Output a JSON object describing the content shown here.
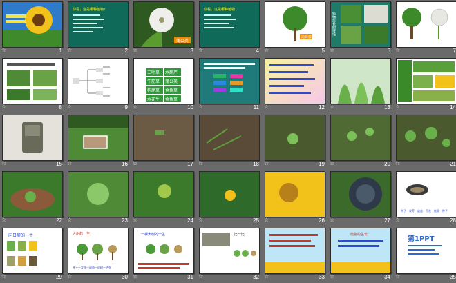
{
  "slides": [
    {
      "number": "1"
    },
    {
      "number": "2",
      "title": "你看，这是哪种植物？"
    },
    {
      "number": "3",
      "tag": "蒲公英"
    },
    {
      "number": "4",
      "title": "你看，这是哪种植物？"
    },
    {
      "number": "5",
      "tag": "向日葵"
    },
    {
      "number": "6",
      "side": "植物生长的环境"
    },
    {
      "number": "7"
    },
    {
      "number": "8"
    },
    {
      "number": "9"
    },
    {
      "number": "10",
      "words": [
        "三叶草",
        "水葫芦",
        "牛筋草",
        "蒲公英",
        "狗尾草",
        "金鱼草",
        "水花生",
        "金鱼草"
      ]
    },
    {
      "number": "11"
    },
    {
      "number": "12"
    },
    {
      "number": "13"
    },
    {
      "number": "14"
    },
    {
      "number": "15"
    },
    {
      "number": "16"
    },
    {
      "number": "17"
    },
    {
      "number": "18"
    },
    {
      "number": "19"
    },
    {
      "number": "20"
    },
    {
      "number": "21"
    },
    {
      "number": "22"
    },
    {
      "number": "23"
    },
    {
      "number": "24"
    },
    {
      "number": "25"
    },
    {
      "number": "26"
    },
    {
      "number": "27"
    },
    {
      "number": "28",
      "caption": "种子—发芽—幼苗—开花—结果—种子"
    },
    {
      "number": "29",
      "title": "向日葵的一生"
    },
    {
      "number": "30",
      "title": "大树的一生",
      "caption": "种子—发芽—幼苗—成树—枯死"
    },
    {
      "number": "31",
      "title": "一棵大树的一生"
    },
    {
      "number": "32",
      "title": "比一比"
    },
    {
      "number": "33"
    },
    {
      "number": "34",
      "title": "植物的生长"
    },
    {
      "number": "35",
      "logo": "第1PPT"
    }
  ],
  "star_glyph": "☆",
  "colors": {
    "background": "#6a6a6a",
    "border": "#2b2b2b"
  }
}
